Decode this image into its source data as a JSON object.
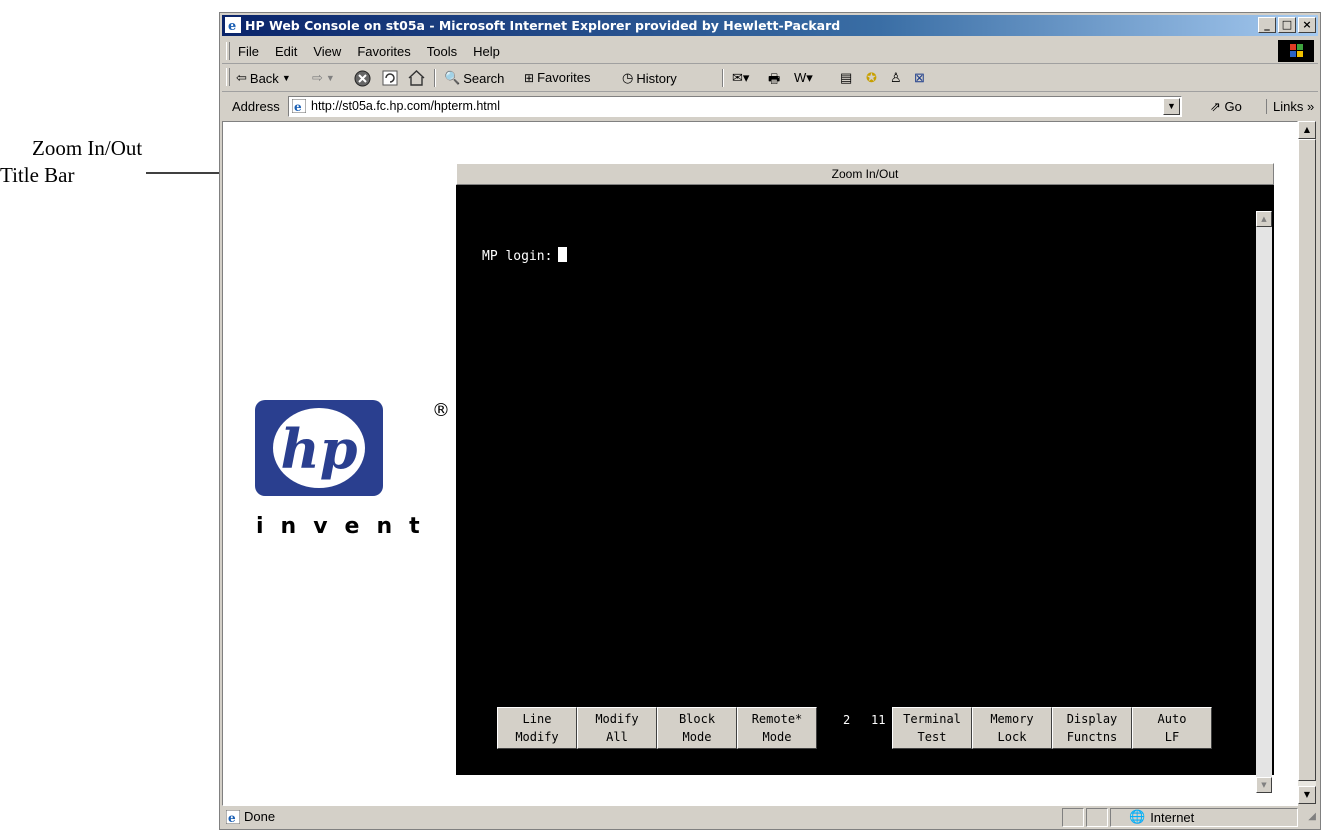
{
  "annotation": {
    "line1": "Zoom In/Out",
    "line2": "Title Bar"
  },
  "window": {
    "title": "HP Web Console on st05a - Microsoft Internet Explorer provided by Hewlett-Packard",
    "buttons": [
      "_",
      "□",
      "×"
    ]
  },
  "menu": [
    "File",
    "Edit",
    "View",
    "Favorites",
    "Tools",
    "Help"
  ],
  "toolbar": {
    "back": "Back",
    "search": "Search",
    "favorites": "Favorites",
    "history": "History"
  },
  "address": {
    "label": "Address",
    "url": "http://st05a.fc.hp.com/hpterm.html",
    "go": "Go",
    "links": "Links »"
  },
  "logo": {
    "text": "hp",
    "registered": "®",
    "tagline": "invent"
  },
  "terminal": {
    "title": "Zoom In/Out",
    "prompt": "MP login:",
    "fkeys": [
      {
        "line1": "Line",
        "line2": "Modify"
      },
      {
        "line1": "Modify",
        "line2": "All"
      },
      {
        "line1": "Block",
        "line2": "Mode"
      },
      {
        "line1": "Remote*",
        "line2": "Mode"
      },
      {
        "line1": "Terminal",
        "line2": "Test"
      },
      {
        "line1": "Memory",
        "line2": "Lock"
      },
      {
        "line1": "Display",
        "line2": "Functns"
      },
      {
        "line1": "Auto",
        "line2": "LF"
      }
    ],
    "page_a": "2",
    "page_b": "11"
  },
  "status": {
    "text": "Done",
    "zone": "Internet"
  }
}
